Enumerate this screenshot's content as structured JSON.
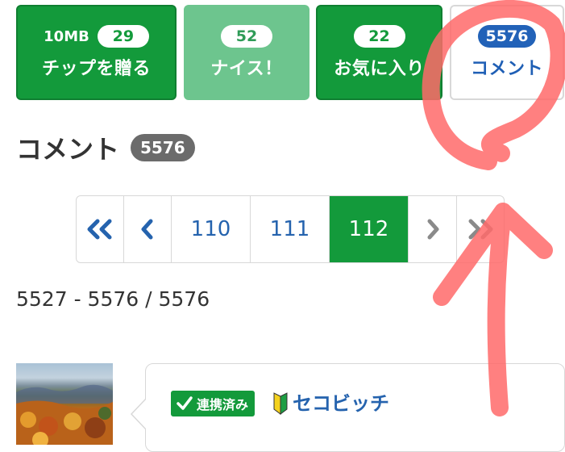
{
  "actions": {
    "tip": {
      "size": "10MB",
      "count": "29",
      "label": "チップを贈る"
    },
    "nice": {
      "count": "52",
      "label": "ナイス！"
    },
    "favorite": {
      "count": "22",
      "label": "お気に入り"
    },
    "comment": {
      "count": "5576",
      "label": "コメント"
    }
  },
  "comments": {
    "heading": "コメント",
    "count": "5576",
    "range": "5527 - 5576 / 5576"
  },
  "pagination": {
    "first": "«",
    "prev": "‹",
    "pages": [
      "110",
      "111",
      "112"
    ],
    "current": "112",
    "next": "›",
    "last": "»"
  },
  "comment_item": {
    "linked_label": "連携済み",
    "username": "セコビッチ"
  },
  "colors": {
    "green": "#139a3b",
    "light_green": "#6dc58e",
    "blue": "#2262b8",
    "link_blue": "#2563ae",
    "annotation_red": "#ff6a6a"
  }
}
